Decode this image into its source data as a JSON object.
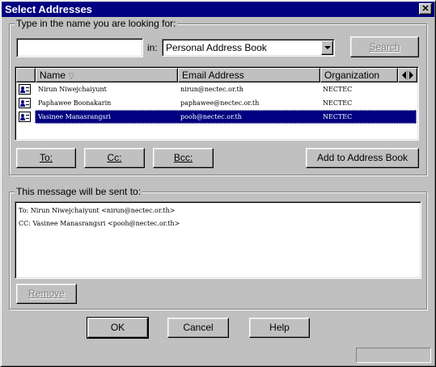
{
  "window": {
    "title": "Select Addresses",
    "close_label": "✕"
  },
  "search": {
    "group_label": "Type in the name you are looking for:",
    "name_value": "",
    "in_label": "in:",
    "book_selected": "Personal Address Book",
    "search_button": "Search"
  },
  "list": {
    "columns": [
      {
        "label": "Name",
        "sort": "▽"
      },
      {
        "label": "Email Address"
      },
      {
        "label": "Organization"
      }
    ],
    "rows": [
      {
        "name": "Nirun Niwejchaiyunt",
        "email": "nirun@nectec.or.th",
        "org": "NECTEC",
        "selected": false
      },
      {
        "name": "Paphawee Boonakarin",
        "email": "paphawee@nectec.or.th",
        "org": "NECTEC",
        "selected": false
      },
      {
        "name": "Vasinee Manasrangsri",
        "email": "pooh@nectec.or.th",
        "org": "NECTEC",
        "selected": true
      }
    ]
  },
  "buttons": {
    "to": "To:",
    "cc": "Cc:",
    "bcc": "Bcc:",
    "add_to_book": "Add to Address Book",
    "remove": "Remove",
    "ok": "OK",
    "cancel": "Cancel",
    "help": "Help"
  },
  "recipients": {
    "group_label": "This message will be sent to:",
    "lines": [
      "To: Nirun Niwejchaiyunt <nirun@nectec.or.th>",
      "CC: Vasinee Manasrangsri <pooh@nectec.or.th>"
    ]
  },
  "icons": {
    "close": "close-icon",
    "dropdown": "chevron-down-icon",
    "contact": "contact-card-icon",
    "scroll_left": "arrow-left-icon",
    "scroll_right": "arrow-right-icon"
  },
  "colors": {
    "face": "#c0c0c0",
    "title_bar": "#000080",
    "selection": "#000080",
    "disabled_text": "#808080"
  }
}
